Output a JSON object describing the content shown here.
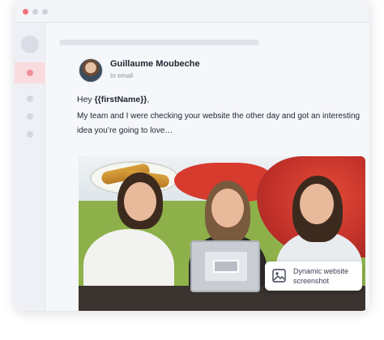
{
  "window": {
    "controls": [
      "close",
      "minimize",
      "maximize"
    ]
  },
  "sidebar": {
    "items": [
      {
        "icon": "profile-avatar-icon"
      },
      {
        "icon": "inbox-dot-icon",
        "active": true
      },
      {
        "icon": "nav-dot-icon"
      },
      {
        "icon": "nav-dot-icon"
      },
      {
        "icon": "nav-dot-icon"
      }
    ],
    "active_color": "#f9dcdf",
    "active_dot_color": "#ef8f9a"
  },
  "email": {
    "sender_name": "Guillaume Moubeche",
    "recipient": "to email",
    "greeting_prefix": "Hey ",
    "greeting_variable": "{{firstName}}",
    "greeting_suffix": ",",
    "body_line_1": "My team and I were checking your website the other day and got an interesting",
    "body_line_2": "idea you’re going to love…"
  },
  "image_card": {
    "badge_line_1": "Dynamic website",
    "badge_line_2": "screenshot",
    "badge_icon": "image-icon"
  }
}
